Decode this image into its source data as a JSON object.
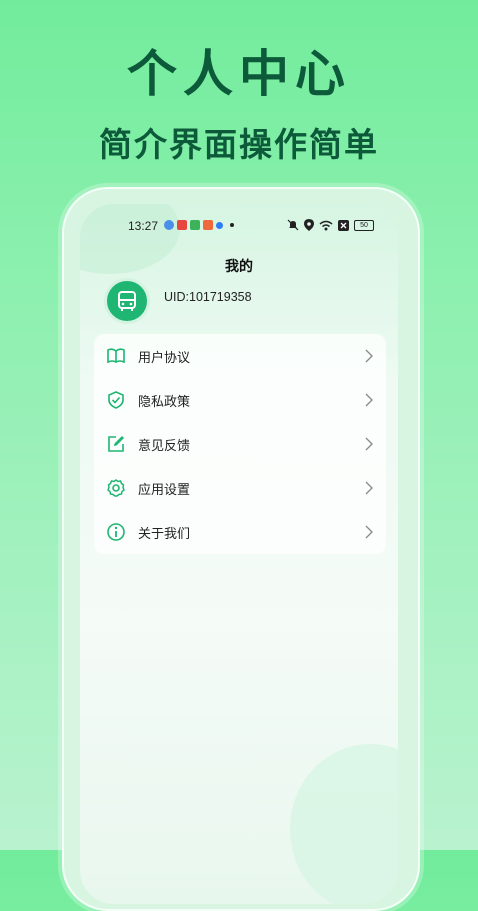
{
  "promo": {
    "title": "个人中心",
    "subtitle": "简介界面操作简单"
  },
  "status_bar": {
    "time": "13:27",
    "battery": "50"
  },
  "header": {
    "title": "我的"
  },
  "profile": {
    "uid": "UID:101719358"
  },
  "menu": {
    "items": [
      {
        "label": "用户协议",
        "icon": "book-icon"
      },
      {
        "label": "隐私政策",
        "icon": "shield-check-icon"
      },
      {
        "label": "意见反馈",
        "icon": "edit-icon"
      },
      {
        "label": "应用设置",
        "icon": "gear-icon"
      },
      {
        "label": "关于我们",
        "icon": "info-icon"
      }
    ]
  },
  "colors": {
    "accent": "#1fb673",
    "promo_text": "#0c5a3a",
    "background": "#72ec9c"
  }
}
